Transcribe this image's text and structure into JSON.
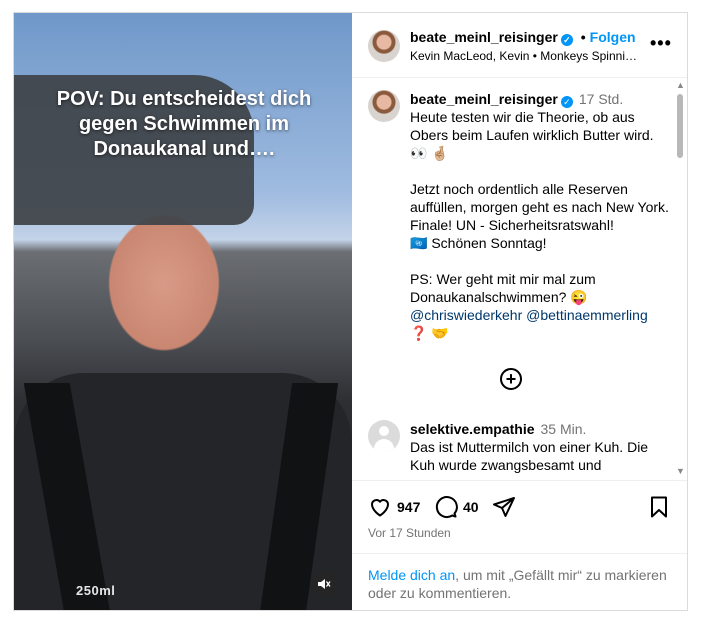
{
  "video": {
    "caption": "POV: Du entscheidest dich gegen Schwimmen im Donaukanal und….",
    "bottle_label": "250ml"
  },
  "header": {
    "username": "beate_meinl_reisinger",
    "separator": "•",
    "follow_label": "Folgen",
    "music": "Kevin MacLeod, Kevin • Monkeys Spinning Monkeys"
  },
  "caption_post": {
    "username": "beate_meinl_reisinger",
    "time": "17 Std.",
    "p1": "Heute testen wir die Theorie, ob aus Obers beim Laufen wirklich Butter wird.",
    "p1_emoji": "👀 🤞🏼",
    "p2": "Jetzt noch ordentlich alle Reserven auffüllen, morgen geht es nach New York. Finale! UN - Sicherheitsratswahl!",
    "p2b": "🇺🇳 Schönen Sonntag!",
    "p3": "PS: Wer geht mit mir mal zum Donaukanalschwimmen? 😜",
    "mention1": "@chriswiederkehr",
    "mention2": "@bettinaemmerling",
    "p3_emoji": "❓ 🤝"
  },
  "comment": {
    "username": "selektive.empathie",
    "time": "35 Min.",
    "text": "Das ist Muttermilch von einer Kuh. Die Kuh wurde zwangsbesamt und"
  },
  "actions": {
    "likes": "947",
    "comments": "40",
    "timestamp": "Vor 17 Stunden"
  },
  "login": {
    "link": "Melde dich an",
    "text": ", um mit „Gefällt mir“ zu markieren oder zu kommentieren."
  },
  "icons": [
    "verified-badge-icon",
    "more-options-icon",
    "mute-icon",
    "add-circle-icon",
    "heart-icon",
    "comment-icon",
    "share-icon",
    "bookmark-icon"
  ],
  "colors": {
    "accent": "#0095f6",
    "mention": "#00376b",
    "muted": "#737373"
  }
}
